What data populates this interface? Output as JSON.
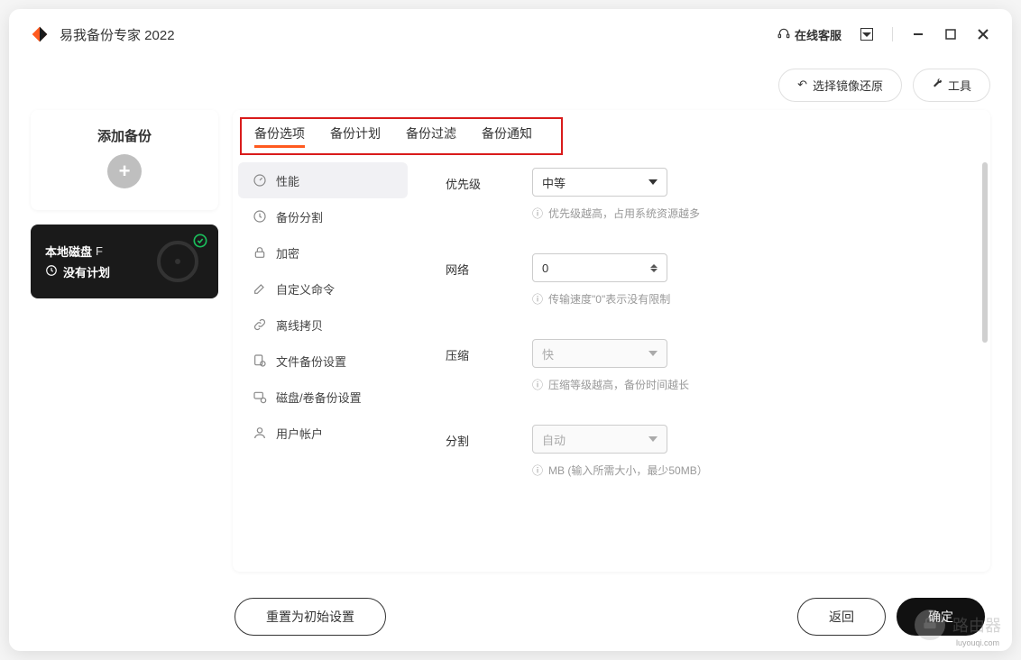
{
  "app_title": "易我备份专家 2022",
  "titlebar": {
    "service": "在线客服"
  },
  "actions": {
    "restore": "选择镜像还原",
    "tools": "工具"
  },
  "left": {
    "add_title": "添加备份",
    "disk_title": "本地磁盘",
    "disk_letter": "F",
    "no_plan": "没有计划"
  },
  "tabs": [
    "备份选项",
    "备份计划",
    "备份过滤",
    "备份通知"
  ],
  "nav": [
    "性能",
    "备份分割",
    "加密",
    "自定义命令",
    "离线拷贝",
    "文件备份设置",
    "磁盘/卷备份设置",
    "用户帐户"
  ],
  "form": {
    "priority_label": "优先级",
    "priority_value": "中等",
    "priority_hint": "优先级越高，占用系统资源越多",
    "network_label": "网络",
    "network_value": "0",
    "network_hint": "传输速度\"0\"表示没有限制",
    "compress_label": "压缩",
    "compress_value": "快",
    "compress_hint": "压缩等级越高，备份时间越长",
    "split_label": "分割",
    "split_value": "自动",
    "split_hint": "MB (输入所需大小，最少50MB）"
  },
  "bottom": {
    "reset": "重置为初始设置",
    "back": "返回",
    "ok": "确定"
  },
  "watermark": {
    "brand": "路由器",
    "domain": "luyouqi.com"
  }
}
